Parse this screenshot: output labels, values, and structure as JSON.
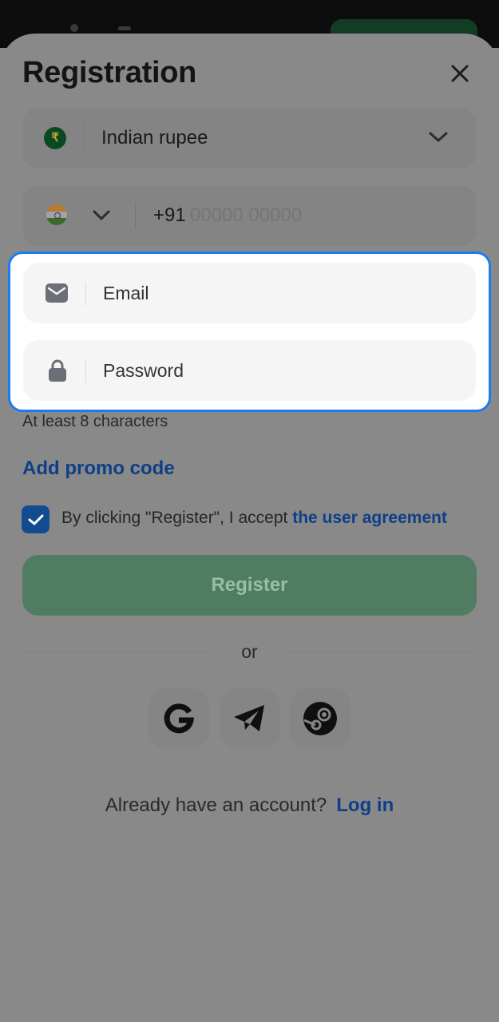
{
  "header": {
    "title": "Registration"
  },
  "currency": {
    "symbol": "₹",
    "label": "Indian rupee"
  },
  "phone": {
    "code": "+91",
    "placeholder": "00000 00000"
  },
  "email": {
    "placeholder": "Email"
  },
  "password": {
    "placeholder": "Password",
    "hint": "At least 8 characters"
  },
  "promo": {
    "label": "Add promo code"
  },
  "agreement": {
    "checked": true,
    "text": "By clicking \"Register\", I accept",
    "link": "the user agreement"
  },
  "register": {
    "label": "Register"
  },
  "divider": {
    "label": "or"
  },
  "social": [
    "google-icon",
    "telegram-icon",
    "steam-icon"
  ],
  "footer": {
    "question": "Already have an account?",
    "login": "Log in"
  },
  "colors": {
    "highlight": "#1a7bf2",
    "link": "#0e3f86",
    "register": "#507c61"
  }
}
